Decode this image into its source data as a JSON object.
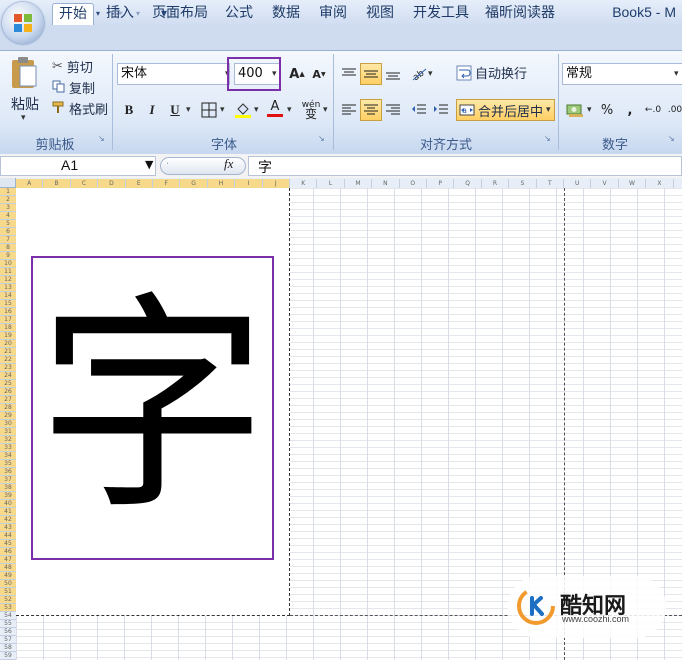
{
  "window": {
    "title": "Book5 - M"
  },
  "quick_access": {
    "save": "💾",
    "undo": "↶",
    "redo": "↷",
    "customize": "▾"
  },
  "tabs": [
    {
      "label": "开始",
      "active": true
    },
    {
      "label": "插入"
    },
    {
      "label": "页面布局"
    },
    {
      "label": "公式"
    },
    {
      "label": "数据"
    },
    {
      "label": "审阅"
    },
    {
      "label": "视图"
    },
    {
      "label": "开发工具"
    },
    {
      "label": "福昕阅读器"
    }
  ],
  "clipboard": {
    "paste": "粘贴",
    "cut": "剪切",
    "copy": "复制",
    "format_painter": "格式刷",
    "group_label": "剪贴板"
  },
  "font": {
    "name": "宋体",
    "size": "400",
    "bold": "B",
    "italic": "I",
    "underline": "U",
    "grow": "A",
    "shrink": "A",
    "font_color_letter": "A",
    "phonetic": "wén",
    "group_label": "字体"
  },
  "alignment": {
    "wrap_text": "自动换行",
    "merge_center": "合并后居中",
    "group_label": "对齐方式"
  },
  "number": {
    "format": "常规",
    "percent": "%",
    "comma": ",",
    "inc_decimal": ".0",
    "dec_decimal": ".00",
    "group_label": "数字"
  },
  "formula_bar": {
    "name_box": "A1",
    "fx": "fx",
    "content": "字"
  },
  "sheet": {
    "cell_content": "字",
    "column_headers": [
      "A",
      "B",
      "C",
      "D",
      "E",
      "F",
      "G",
      "H",
      "I",
      "J",
      "K",
      "L",
      "M",
      "N",
      "O",
      "P",
      "Q",
      "R",
      "S",
      "T",
      "U",
      "V",
      "W",
      "X"
    ],
    "row_count": 59
  },
  "watermark": {
    "brand": "酷知网",
    "url": "www.coozhi.com"
  },
  "colors": {
    "highlight_box": "#7b2fa8",
    "accent": "#1f3d6d",
    "selection": "#f2c564"
  }
}
